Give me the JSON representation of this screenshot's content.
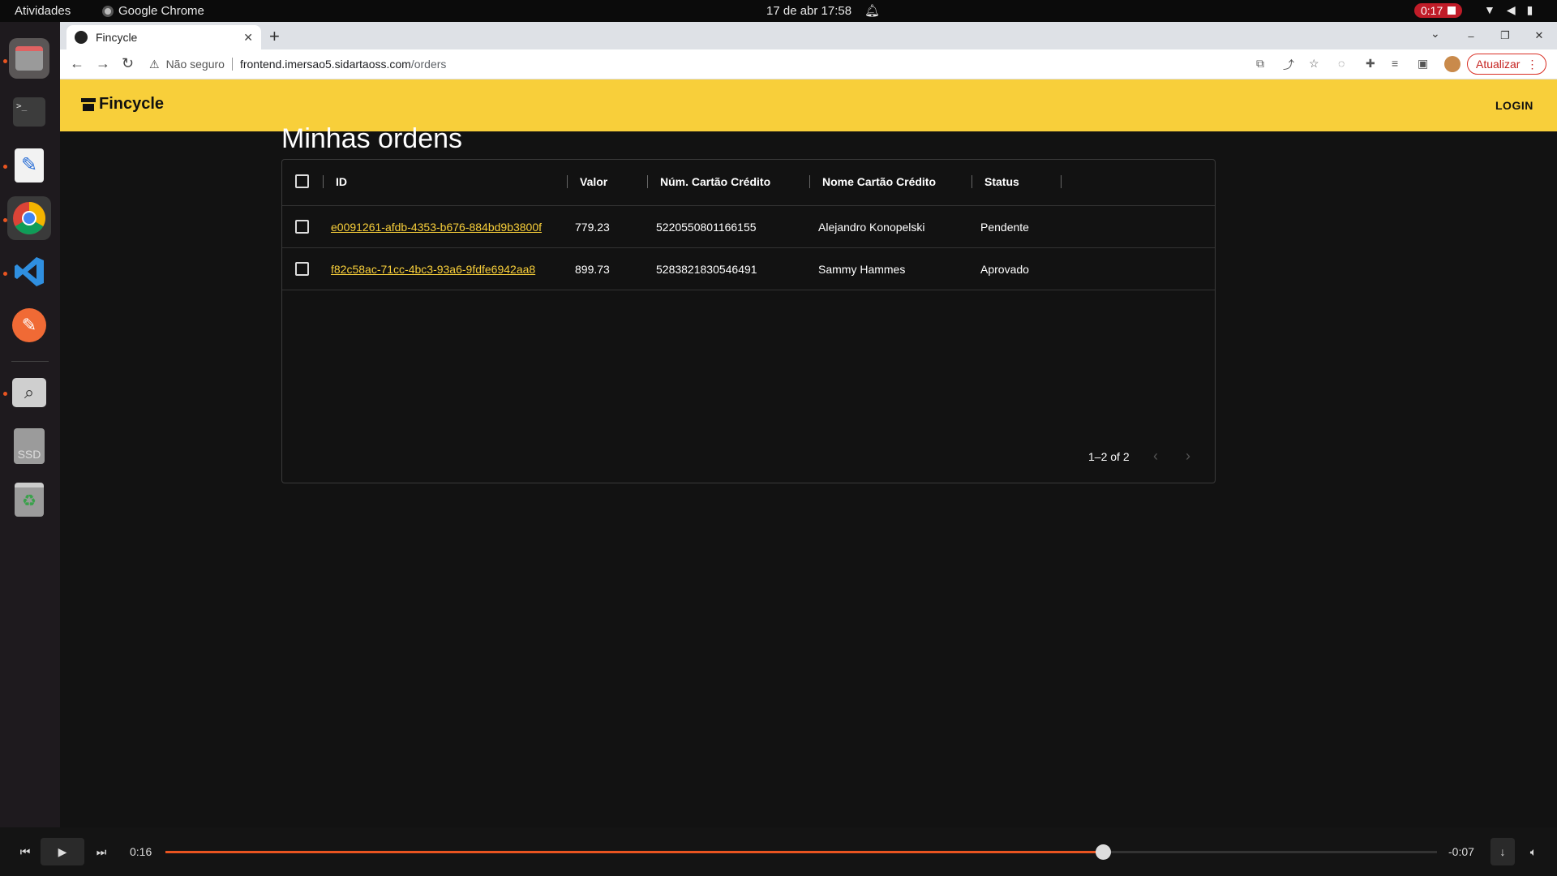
{
  "topbar": {
    "activities": "Atividades",
    "app_name": "Google Chrome",
    "clock": "17 de abr  17:58",
    "recording_time": "0:17"
  },
  "dock": {
    "items": [
      "files",
      "terminal",
      "text-editor",
      "chrome",
      "vscode",
      "insomnia",
      "image-viewer",
      "ssd-drive",
      "trash"
    ],
    "ssd_label": "SSD"
  },
  "browser": {
    "tab_title": "Fincycle",
    "security_label": "Não seguro",
    "url_host": "frontend.imersao5.sidartaoss.com",
    "url_path": "/orders",
    "update_button": "Atualizar"
  },
  "app": {
    "brand": "Fincycle",
    "login": "LOGIN",
    "accent_color": "#f8cf3a"
  },
  "orders": {
    "title": "Minhas ordens",
    "columns": [
      "ID",
      "Valor",
      "Núm. Cartão Crédito",
      "Nome Cartão Crédito",
      "Status"
    ],
    "rows": [
      {
        "id": "e0091261-afdb-4353-b676-884bd9b3800f",
        "valor": "779.23",
        "card_number": "5220550801166155",
        "card_name": "Alejandro Konopelski",
        "status": "Pendente"
      },
      {
        "id": "f82c58ac-71cc-4bc3-93a6-9fdfe6942aa8",
        "valor": "899.73",
        "card_number": "5283821830546491",
        "card_name": "Sammy Hammes",
        "status": "Aprovado"
      }
    ],
    "pagination": "1–2 of 2"
  },
  "player": {
    "elapsed": "0:16",
    "remaining": "-0:07",
    "progress": 0.737
  }
}
